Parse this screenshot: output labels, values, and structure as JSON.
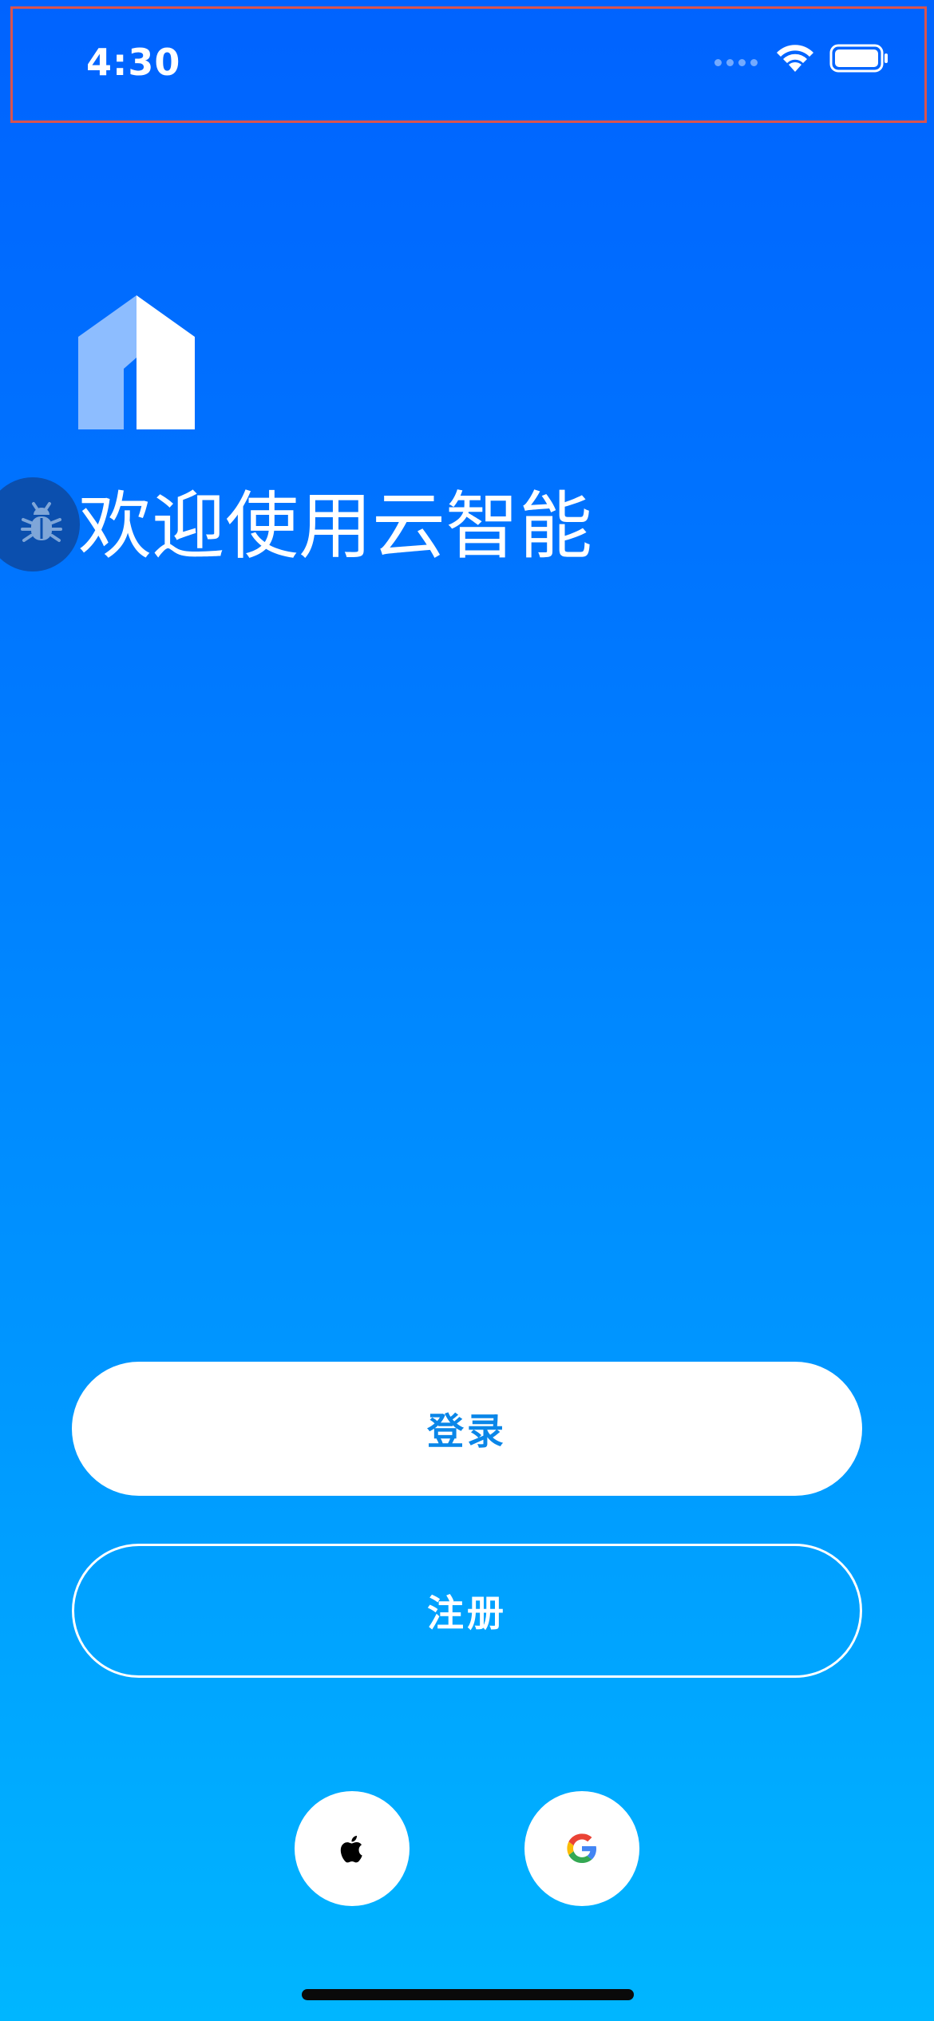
{
  "status_bar": {
    "time": "4:30"
  },
  "welcome": {
    "title": "欢迎使用云智能"
  },
  "actions": {
    "login_label": "登录",
    "register_label": "注册"
  },
  "social_login": [
    {
      "provider": "apple",
      "icon": "apple-icon"
    },
    {
      "provider": "google",
      "icon": "google-icon"
    }
  ],
  "colors": {
    "gradient_top": "#0063FF",
    "gradient_bottom": "#00B6FF",
    "login_text": "#0A86E8",
    "debug_bubble": "#0B4FAE"
  }
}
